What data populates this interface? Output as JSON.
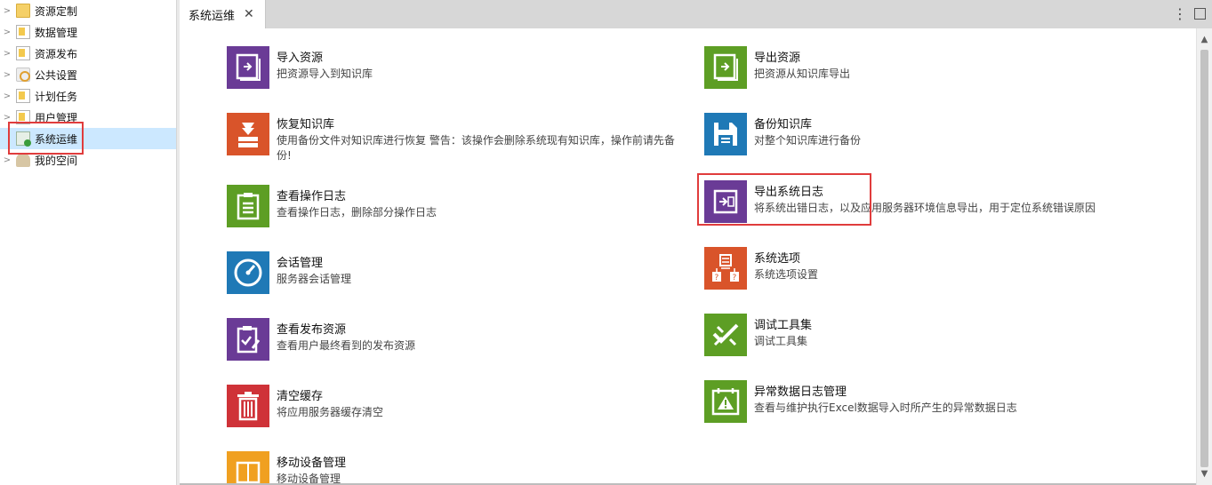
{
  "tree": {
    "items": [
      {
        "label": "资源定制",
        "icon": "folder-icon"
      },
      {
        "label": "数据管理",
        "icon": "document-icon"
      },
      {
        "label": "资源发布",
        "icon": "document-icon"
      },
      {
        "label": "公共设置",
        "icon": "settings-icon"
      },
      {
        "label": "计划任务",
        "icon": "document-icon"
      },
      {
        "label": "用户管理",
        "icon": "user-management-icon"
      },
      {
        "label": "系统运维",
        "icon": "system-maintenance-icon",
        "selected": true
      },
      {
        "label": "我的空间",
        "icon": "user-icon"
      }
    ]
  },
  "tabs": [
    {
      "label": "系统运维",
      "close": "✕"
    }
  ],
  "toolbar": {
    "more": "⋮"
  },
  "cards": [
    {
      "title": "导入资源",
      "desc": "把资源导入到知识库",
      "color": "#6a3b96",
      "icon": "import-icon"
    },
    {
      "title": "导出资源",
      "desc": "把资源从知识库导出",
      "color": "#5d9e24",
      "icon": "export-icon"
    },
    {
      "title": "恢复知识库",
      "desc": "使用备份文件对知识库进行恢复 警告：该操作会删除系统现有知识库，操作前请先备份!",
      "color": "#d9542a",
      "icon": "restore-icon"
    },
    {
      "title": "备份知识库",
      "desc": "对整个知识库进行备份",
      "color": "#1f79b6",
      "icon": "save-icon"
    },
    {
      "title": "查看操作日志",
      "desc": "查看操作日志，删除部分操作日志",
      "color": "#5d9e24",
      "icon": "log-icon"
    },
    {
      "title": "导出系统日志",
      "desc": "将系统出错日志，以及应用服务器环境信息导出，用于定位系统错误原因",
      "color": "#6a3b96",
      "icon": "export-log-icon"
    },
    {
      "title": "会话管理",
      "desc": "服务器会话管理",
      "color": "#1f79b6",
      "icon": "gauge-icon"
    },
    {
      "title": "系统选项",
      "desc": "系统选项设置",
      "color": "#d9542a",
      "icon": "options-icon"
    },
    {
      "title": "查看发布资源",
      "desc": "查看用户最终看到的发布资源",
      "color": "#6a3b96",
      "icon": "checklist-icon"
    },
    {
      "title": "调试工具集",
      "desc": "调试工具集",
      "color": "#5d9e24",
      "icon": "tools-icon"
    },
    {
      "title": "清空缓存",
      "desc": "将应用服务器缓存清空",
      "color": "#cf3238",
      "icon": "trash-icon"
    },
    {
      "title": "异常数据日志管理",
      "desc": "查看与维护执行Excel数据导入时所产生的异常数据日志",
      "color": "#5d9e24",
      "icon": "warning-icon"
    },
    {
      "title": "移动设备管理",
      "desc": "移动设备管理",
      "color": "#f0a020",
      "icon": "mobile-icon"
    }
  ],
  "scrollbar": {
    "up": "▲",
    "down": "▼"
  }
}
